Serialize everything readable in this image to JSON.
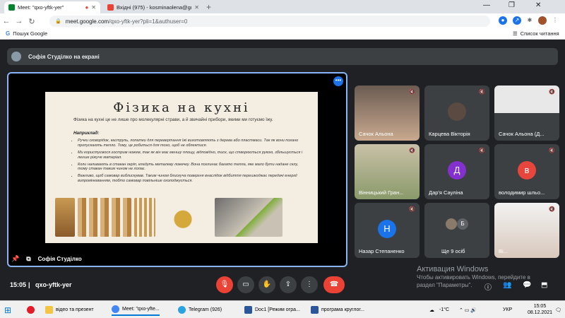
{
  "browser": {
    "tabs": [
      {
        "label": "Meet: \"qxo-yftk-yer\"",
        "icon": "meet-icon",
        "color": "#00832d",
        "active": true
      },
      {
        "label": "Вхідні (975) - kosminaolena@gm",
        "icon": "gmail-icon",
        "color": "#ea4335",
        "active": false
      }
    ],
    "url_host": "meet.google.com",
    "url_path": "/qxo-yftk-yer?pli=1&authuser=0",
    "bookmark": "Пошук Google",
    "reading_list": "Список читання"
  },
  "meet": {
    "presenting_banner": "Софія Студілко на екрані",
    "presenter_name": "Софія Студілко",
    "time": "15:05",
    "code": "qxo-yftk-yer",
    "participants": [
      {
        "name": "Сачок Альона",
        "type": "video"
      },
      {
        "name": "Карцева Вікторія",
        "type": "photo"
      },
      {
        "name": "Сачок Альона (Д...",
        "type": "screen"
      },
      {
        "name": "Вінницький Гран...",
        "type": "video"
      },
      {
        "name": "Дар'я Сауліна",
        "type": "avatar",
        "letter": "Д",
        "color": "#8430ce"
      },
      {
        "name": "володимир шльо...",
        "type": "avatar",
        "letter": "в",
        "color": "#e8453c"
      },
      {
        "name": "Назар Степаненко",
        "type": "avatar",
        "letter": "Н",
        "color": "#1a73e8"
      },
      {
        "name": "Ще 9 осіб",
        "type": "more",
        "letter": "Б"
      },
      {
        "name": "Ві...",
        "type": "video"
      }
    ]
  },
  "slide": {
    "title": "Фізика на кухні",
    "intro": "Фізика на кухні це не лише про молекулярні страви, а й звичайні прибори, якими ми готуємо їжу.",
    "heading": "Наприклад:",
    "bullets": [
      "Ручки сковорідок, каструль, лопатки для перевертання їжі виготовляють з дерева або пластмаси. Так як вони погано пропускають тепло. Тому, це робиться для того, щоб не обпектися.",
      "Ми користуємося гострим ножем, так як він має меншу площу, відповідно, тиск, що створюється рукою, збільшується і легше ріжуче матеріал.",
      "Коли наливають в стакан окріп, кладуть металеву ложечку. Вона поглинає багато тепла, яке мало бути надане склу, тому стакан таким чином не лопає.",
      "Важливо, щоб самовар виблискував. Таким чином блискуча поверхня внаслідок відбиття перешкоджає передачі енергії випромінюванням, тобто самовар повільніше охолоджується."
    ]
  },
  "watermark": {
    "line1": "Активация Windows",
    "line2": "Чтобы активировать Windows, перейдите в",
    "line3": "раздел \"Параметры\"."
  },
  "taskbar": {
    "items": [
      {
        "label": "відео та презент",
        "color": "#f4c542"
      },
      {
        "label": "Meet: \"qxo-yfte...",
        "color": "#4285f4"
      },
      {
        "label": "Telegram (926)",
        "color": "#2aa3e0"
      },
      {
        "label": "Doc1 [Режим огра...",
        "color": "#2b579a"
      },
      {
        "label": "програма круглог...",
        "color": "#2b579a"
      }
    ],
    "weather": "-1°C",
    "lang": "УКР",
    "clock_time": "15:05",
    "clock_date": "08.12.2021"
  }
}
